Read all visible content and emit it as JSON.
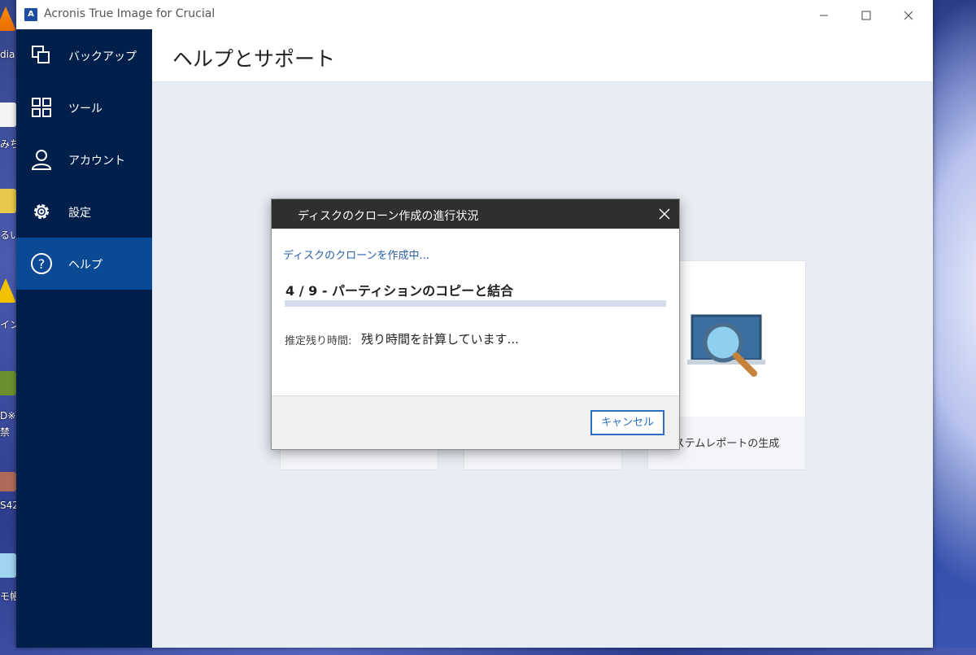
{
  "desktop": {
    "labels": [
      "dia",
      "みち",
      "るい",
      "イン",
      "D※",
      "禁",
      "S42",
      "モ帳"
    ]
  },
  "window": {
    "title": "Acronis True Image for Crucial",
    "minimize_icon": "minimize-icon",
    "maximize_icon": "maximize-icon",
    "close_icon": "close-icon"
  },
  "sidebar": {
    "items": [
      {
        "label": "バックアップ",
        "icon": "backup-icon"
      },
      {
        "label": "ツール",
        "icon": "tools-grid-icon"
      },
      {
        "label": "アカウント",
        "icon": "account-icon"
      },
      {
        "label": "設定",
        "icon": "gear-icon"
      },
      {
        "label": "ヘルプ",
        "icon": "help-icon",
        "active": true
      }
    ]
  },
  "header": {
    "title": "ヘルプとサポート"
  },
  "cards": [
    {
      "label": ""
    },
    {
      "label": ""
    },
    {
      "label": "ステムレポートの生成",
      "icon": "magnifier-laptop-icon"
    }
  ],
  "dialog": {
    "title": "ディスクのクローン作成の進行状況",
    "status": "ディスクのクローンを作成中...",
    "step": "4 / 9 - パーティションのコピーと結合",
    "progress": 0,
    "estimate_label": "推定残り時間:",
    "estimate_value": "残り時間を計算しています...",
    "cancel_label": "キャンセル"
  },
  "colors": {
    "sidebar": "#00204b",
    "sidebar_active": "#0a4a94",
    "accent": "#2a6fc4",
    "dialog_title": "#2f2f2f"
  }
}
